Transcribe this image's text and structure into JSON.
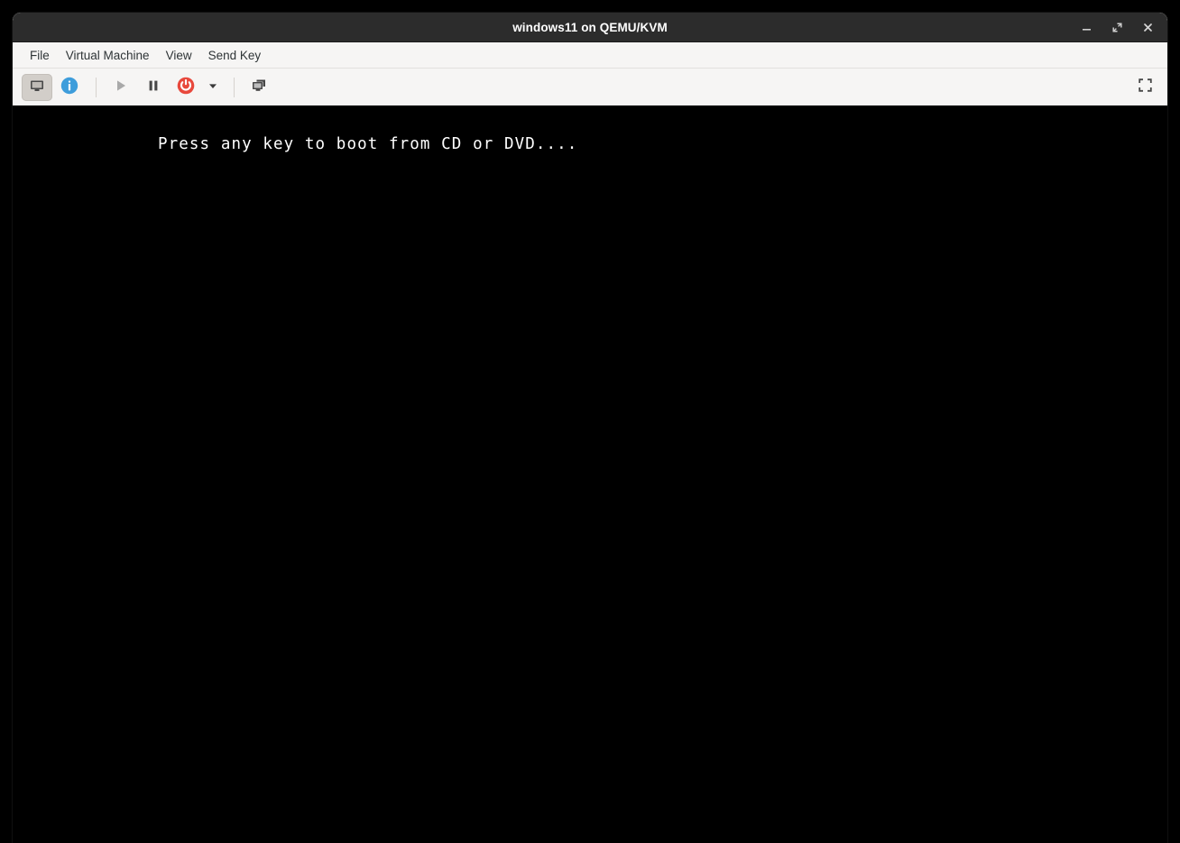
{
  "window": {
    "title": "windows11 on QEMU/KVM",
    "controls": [
      {
        "name": "minimize",
        "glyph": "minimize-icon",
        "label": "Minimize"
      },
      {
        "name": "maximize",
        "glyph": "maximize-icon",
        "label": "Restore"
      },
      {
        "name": "close",
        "glyph": "close-icon",
        "label": "Close"
      }
    ]
  },
  "menubar": {
    "items": [
      {
        "label": "File"
      },
      {
        "label": "Virtual Machine"
      },
      {
        "label": "View"
      },
      {
        "label": "Send Key"
      }
    ]
  },
  "toolbar": {
    "buttons": [
      {
        "name": "show-console-button",
        "icon": "monitor-icon",
        "label": "Console",
        "state": "active",
        "enabled": true
      },
      {
        "name": "show-details-button",
        "icon": "info-icon",
        "label": "Details",
        "state": "normal",
        "enabled": true
      },
      {
        "name": "run-button",
        "icon": "play-icon",
        "label": "Run",
        "state": "disabled",
        "enabled": false
      },
      {
        "name": "pause-button",
        "icon": "pause-icon",
        "label": "Pause",
        "state": "normal",
        "enabled": true
      },
      {
        "name": "shutdown-button",
        "icon": "power-icon",
        "label": "Shut Down",
        "state": "normal",
        "enabled": true
      },
      {
        "name": "shutdown-menu-button",
        "icon": "chevron-down-icon",
        "label": "Shut Down Options",
        "state": "normal",
        "enabled": true
      },
      {
        "name": "snapshots-button",
        "icon": "snapshots-icon",
        "label": "Manage VM Snapshots",
        "state": "normal",
        "enabled": true
      }
    ],
    "fullscreen": {
      "name": "fullscreen-button",
      "icon": "fullscreen-icon",
      "label": "Fullscreen"
    }
  },
  "console": {
    "text": "Press any key to boot from CD or DVD....",
    "background": "#000000",
    "foreground": "#ffffff"
  },
  "colors": {
    "titlebar_bg": "#2c2c2c",
    "chrome_bg": "#f6f5f4",
    "accent_info": "#3e9ddb",
    "accent_power": "#e8483c",
    "icon_dark": "#474747",
    "icon_disabled": "#a9a9a9",
    "desktop_bg": "#000000"
  }
}
